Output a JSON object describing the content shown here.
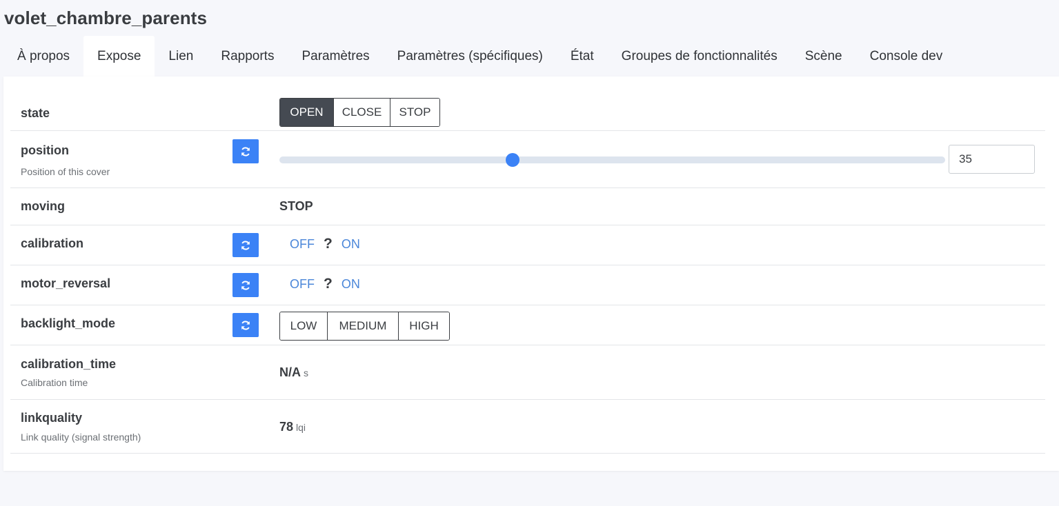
{
  "page": {
    "title": "volet_chambre_parents"
  },
  "tabs": [
    {
      "label": "À propos"
    },
    {
      "label": "Expose",
      "active": true
    },
    {
      "label": "Lien"
    },
    {
      "label": "Rapports"
    },
    {
      "label": "Paramètres"
    },
    {
      "label": "Paramètres (spécifiques)"
    },
    {
      "label": "État"
    },
    {
      "label": "Groupes de fonctionnalités"
    },
    {
      "label": "Scène"
    },
    {
      "label": "Console dev"
    }
  ],
  "colors": {
    "accent": "#3b82f6",
    "active_segment": "#454a52",
    "link": "#4a86d9"
  },
  "icons": {
    "refresh": "refresh-icon"
  },
  "rows": {
    "state": {
      "name": "state",
      "options": [
        "OPEN",
        "CLOSE",
        "STOP"
      ],
      "selected": "OPEN"
    },
    "position": {
      "name": "position",
      "description": "Position of this cover",
      "value": "35",
      "min": 0,
      "max": 100
    },
    "moving": {
      "name": "moving",
      "value": "STOP"
    },
    "calibration": {
      "name": "calibration",
      "off": "OFF",
      "unknown": "?",
      "on": "ON"
    },
    "motor_reversal": {
      "name": "motor_reversal",
      "off": "OFF",
      "unknown": "?",
      "on": "ON"
    },
    "backlight_mode": {
      "name": "backlight_mode",
      "options": [
        "LOW",
        "MEDIUM",
        "HIGH"
      ]
    },
    "calibration_time": {
      "name": "calibration_time",
      "description": "Calibration time",
      "value": "N/A",
      "unit": "s"
    },
    "linkquality": {
      "name": "linkquality",
      "description": "Link quality (signal strength)",
      "value": "78",
      "unit": "lqi"
    }
  }
}
